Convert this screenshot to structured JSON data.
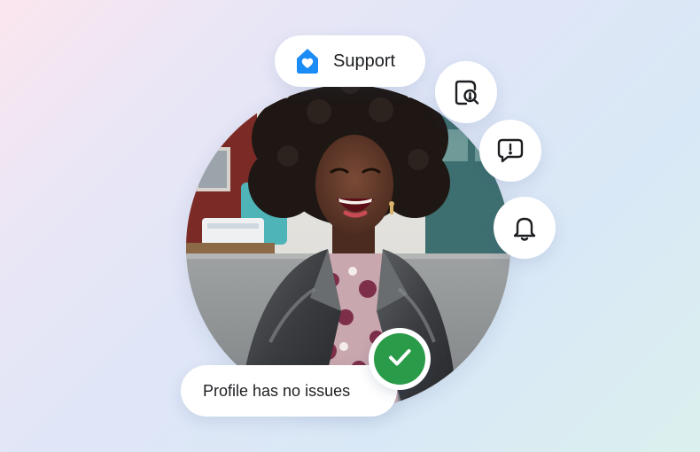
{
  "support_pill": {
    "label": "Support",
    "icon": "house-heart-icon",
    "icon_color": "#1b8cf5"
  },
  "status_pill": {
    "label": "Profile has no issues"
  },
  "actions": [
    {
      "icon": "document-search-icon"
    },
    {
      "icon": "speech-bubble-alert-icon"
    },
    {
      "icon": "bell-icon"
    }
  ],
  "status_badge": {
    "icon": "checkmark-icon",
    "color": "#2a9b48"
  },
  "background": {
    "gradient_stops": [
      "#fbe6ee",
      "#dfe6f7",
      "#dbf0ee"
    ]
  }
}
